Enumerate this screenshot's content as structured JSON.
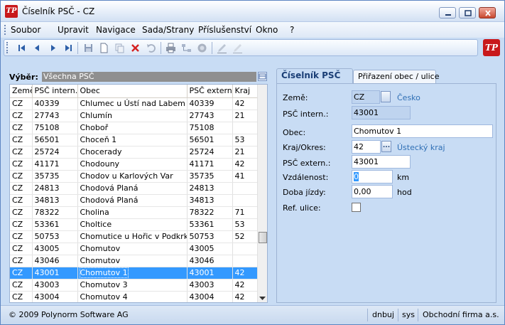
{
  "window": {
    "title": "Číselník PSČ - CZ",
    "logo": "TP"
  },
  "menu": [
    "Soubor",
    "Upravit",
    "Navigace",
    "Sada/Strany",
    "Příslušenství",
    "Okno",
    "?"
  ],
  "toolbar": {
    "icons": [
      "first-record-icon",
      "previous-record-icon",
      "next-record-icon",
      "last-record-icon",
      "save-icon",
      "new-record-icon",
      "copy-icon",
      "delete-icon",
      "undo-icon",
      "print-icon",
      "tree-icon",
      "filter-icon",
      "edit-icon",
      "edit-disabled-icon"
    ]
  },
  "selector": {
    "label": "Výběr:",
    "value": "Všechna PSČ"
  },
  "grid": {
    "columns": [
      "Země",
      "PSČ intern.",
      "Obec",
      "PSČ extern.",
      "Kraj"
    ],
    "rows": [
      [
        "CZ",
        "40339",
        "Chlumec u Ústí nad Labem",
        "40339",
        "42"
      ],
      [
        "CZ",
        "27743",
        "Chlumín",
        "27743",
        "21"
      ],
      [
        "CZ",
        "75108",
        "Choboř",
        "75108",
        ""
      ],
      [
        "CZ",
        "56501",
        "Choceň 1",
        "56501",
        "53"
      ],
      [
        "CZ",
        "25724",
        "Chocerady",
        "25724",
        "21"
      ],
      [
        "CZ",
        "41171",
        "Chodouny",
        "41171",
        "42"
      ],
      [
        "CZ",
        "35735",
        "Chodov u Karlových Var",
        "35735",
        "41"
      ],
      [
        "CZ",
        "24813",
        "Chodová Planá",
        "24813",
        ""
      ],
      [
        "CZ",
        "34813",
        "Chodová Planá",
        "34813",
        ""
      ],
      [
        "CZ",
        "78322",
        "Cholina",
        "78322",
        "71"
      ],
      [
        "CZ",
        "53361",
        "Choltice",
        "53361",
        "53"
      ],
      [
        "CZ",
        "50753",
        "Chomutice u Hořic v Podkrkonc",
        "50753",
        "52"
      ],
      [
        "CZ",
        "43005",
        "Chomutov",
        "43005",
        ""
      ],
      [
        "CZ",
        "43046",
        "Chomutov",
        "43046",
        ""
      ],
      [
        "CZ",
        "43001",
        "Chomutov 1",
        "43001",
        "42"
      ],
      [
        "CZ",
        "43003",
        "Chomutov 3",
        "43003",
        "42"
      ],
      [
        "CZ",
        "43004",
        "Chomutov 4",
        "43004",
        "42"
      ]
    ],
    "selected_index": 14
  },
  "tabs": [
    "Číselník PSČ",
    "Přiřazení obec / ulice"
  ],
  "form": {
    "zeme_label": "Země:",
    "zeme_value": "CZ",
    "zeme_name": "Česko",
    "psc_intern_label": "PSČ intern.:",
    "psc_intern_value": "43001",
    "obec_label": "Obec:",
    "obec_value": "Chomutov 1",
    "kraj_label": "Kraj/Okres:",
    "kraj_value": "42",
    "kraj_name": "Ústecký kraj",
    "kraj_button": "...",
    "psc_extern_label": "PSČ extern.:",
    "psc_extern_value": "43001",
    "vzdalenost_label": "Vzdálenost:",
    "vzdalenost_value": "0",
    "vzdalenost_unit": "km",
    "doba_label": "Doba jízdy:",
    "doba_value": "0,00",
    "doba_unit": "hod",
    "ref_label": "Ref. ulice:"
  },
  "status": {
    "copyright": "© 2009 Polynorm Software AG",
    "user": "dnbuj",
    "system": "sys",
    "firm": "Obchodní firma a.s."
  }
}
